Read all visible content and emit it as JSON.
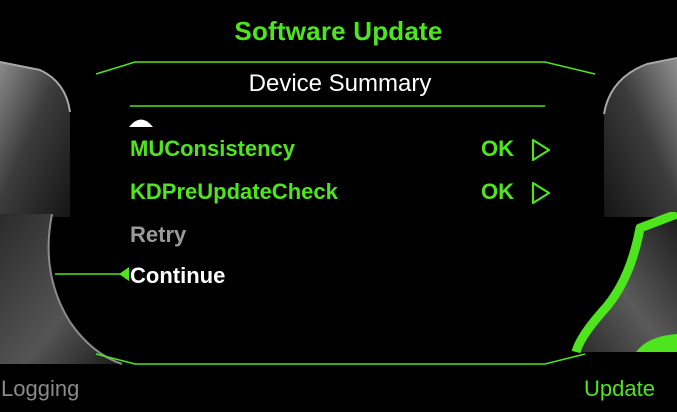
{
  "screen": {
    "title": "Software Update",
    "subtitle": "Device Summary"
  },
  "menu": {
    "items": [
      {
        "label": "MUConsistency",
        "value": "OK",
        "color": "#4ee51f"
      },
      {
        "label": "KDPreUpdateCheck",
        "value": "OK",
        "color": "#4ee51f"
      },
      {
        "label": "Retry",
        "value": "",
        "color": "#9a9a9a"
      },
      {
        "label": "Continue",
        "value": "",
        "color": "#ffffff"
      }
    ]
  },
  "softkeys": {
    "left_bottom": {
      "label": "Logging",
      "color": "#8a8a8a"
    },
    "right_bottom": {
      "label": "Update",
      "color": "#4ee51f"
    }
  },
  "colors": {
    "accent": "#4ee51f",
    "background": "#000000",
    "text_primary": "#ffffff",
    "text_disabled": "#9a9a9a"
  },
  "icons": {
    "scroll_up": "triangle-up-icon",
    "row_action": "triangle-right-outline-icon",
    "selection_pointer": "triangle-left-icon"
  }
}
